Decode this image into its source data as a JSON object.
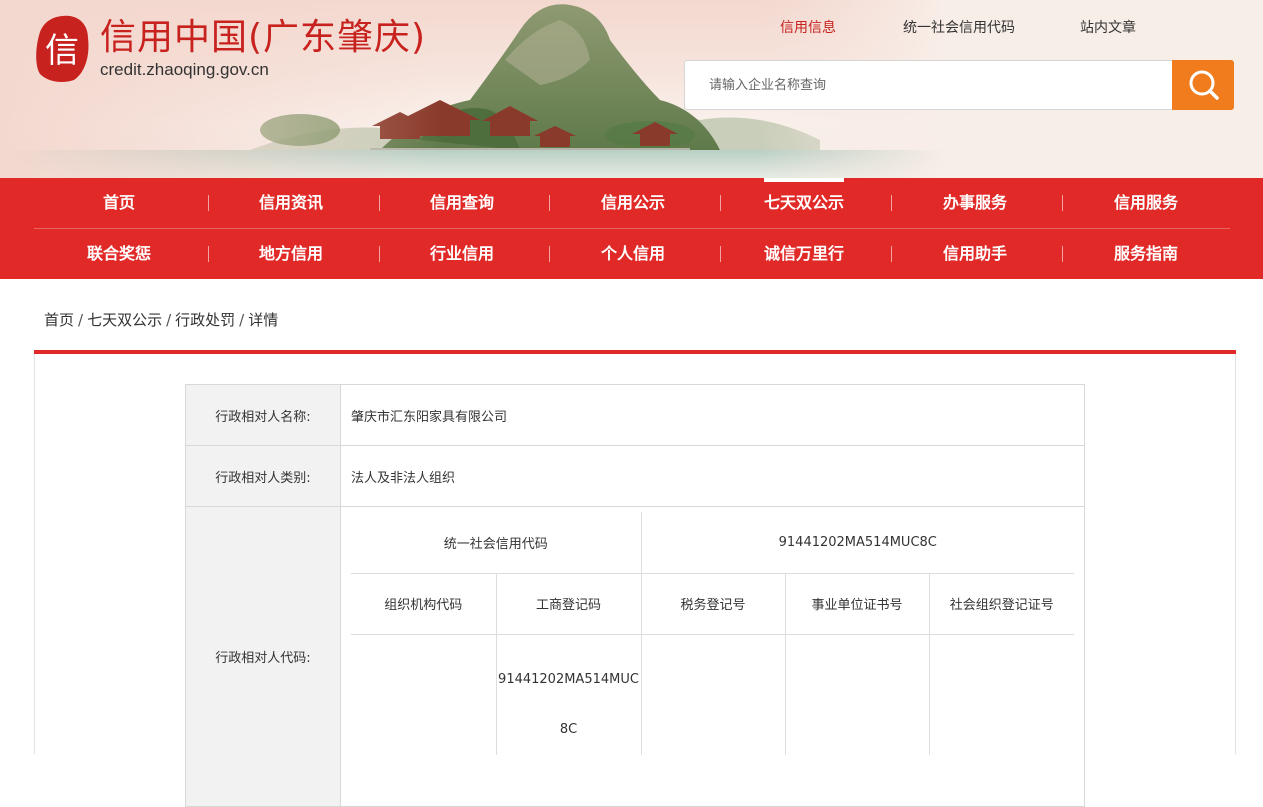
{
  "header": {
    "logo_char": "信",
    "site_title": "信用中国(广东肇庆)",
    "site_url": "credit.zhaoqing.gov.cn",
    "top_links": [
      {
        "label": "信用信息",
        "active": true
      },
      {
        "label": "统一社会信用代码",
        "active": false
      },
      {
        "label": "站内文章",
        "active": false
      }
    ],
    "search_placeholder": "请输入企业名称查询"
  },
  "nav": {
    "row1": [
      "首页",
      "信用资讯",
      "信用查询",
      "信用公示",
      "七天双公示",
      "办事服务",
      "信用服务"
    ],
    "row2": [
      "联合奖惩",
      "地方信用",
      "行业信用",
      "个人信用",
      "诚信万里行",
      "信用助手",
      "服务指南"
    ],
    "current": "七天双公示"
  },
  "breadcrumb": [
    "首页",
    "七天双公示",
    "行政处罚",
    "详情"
  ],
  "breadcrumb_sep": "/",
  "detail": {
    "name_label": "行政相对人名称:",
    "name_value": "肇庆市汇东阳家具有限公司",
    "category_label": "行政相对人类别:",
    "category_value": "法人及非法人组织",
    "code_label": "行政相对人代码:",
    "codes": {
      "uscc_label": "统一社会信用代码",
      "uscc_value": "91441202MA514MUC8C",
      "headers": [
        "组织机构代码",
        "工商登记码",
        "税务登记号",
        "事业单位证书号",
        "社会组织登记证号"
      ],
      "values": [
        "",
        "91441202MA514MUC8C",
        "",
        "",
        ""
      ]
    }
  },
  "colors": {
    "brand_red": "#e12a28",
    "title_red": "#c8221f",
    "search_orange": "#f07c1e"
  }
}
